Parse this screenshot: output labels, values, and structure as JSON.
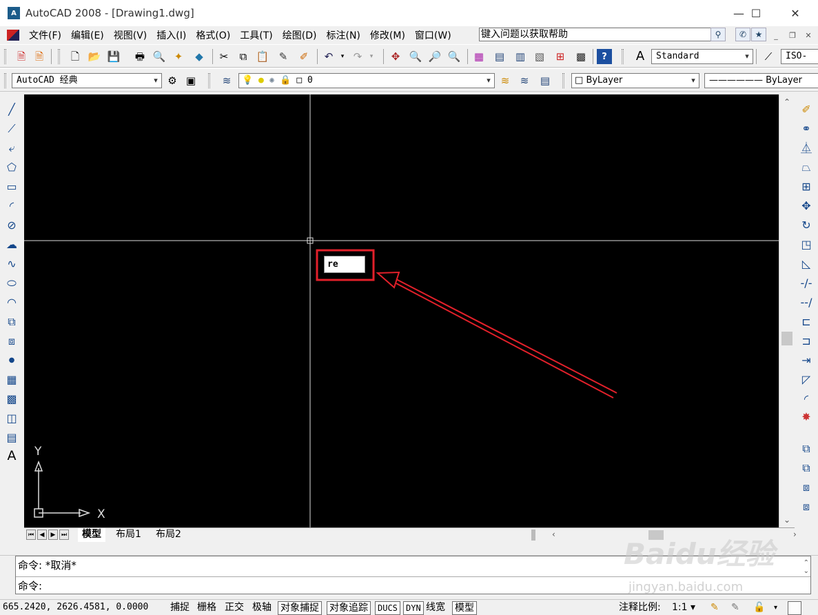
{
  "window": {
    "title": "AutoCAD 2008 - [Drawing1.dwg]",
    "app_icon": "A",
    "minimize": "—",
    "maximize": "☐",
    "close": "✕"
  },
  "menu": {
    "items": [
      "文件(F)",
      "编辑(E)",
      "视图(V)",
      "插入(I)",
      "格式(O)",
      "工具(T)",
      "绘图(D)",
      "标注(N)",
      "修改(M)",
      "窗口(W)"
    ],
    "help_placeholder": "键入问题以获取帮助"
  },
  "toolbar2": {
    "text_style": "Standard",
    "dim_style": "ISO-"
  },
  "toolbar3": {
    "workspace": "AutoCAD 经典",
    "layer": "0",
    "color": "ByLayer",
    "linetype": "ByLayer"
  },
  "canvas": {
    "dynamic_input_value": "re",
    "ucs_x": "X",
    "ucs_y": "Y",
    "annotation_color": "#e2202a",
    "background": "#000000"
  },
  "tabs": {
    "items": [
      "模型",
      "布局1",
      "布局2"
    ],
    "active": "模型"
  },
  "command": {
    "history": "命令: *取消*",
    "prompt": "命令:"
  },
  "status": {
    "coords": "665.2420,  2626.4581, 0.0000",
    "toggles": [
      {
        "label": "捕捉",
        "on": false
      },
      {
        "label": "栅格",
        "on": false
      },
      {
        "label": "正交",
        "on": false
      },
      {
        "label": "极轴",
        "on": false
      },
      {
        "label": "对象捕捉",
        "on": true
      },
      {
        "label": "对象追踪",
        "on": true
      },
      {
        "label": "DUCS",
        "on": true
      },
      {
        "label": "DYN",
        "on": true
      },
      {
        "label": "线宽",
        "on": false
      },
      {
        "label": "模型",
        "on": true
      }
    ],
    "annotation_scale_label": "注释比例:",
    "annotation_scale_value": "1:1"
  },
  "watermark": {
    "brand": "Baidu经验",
    "url": "jingyan.baidu.com"
  }
}
